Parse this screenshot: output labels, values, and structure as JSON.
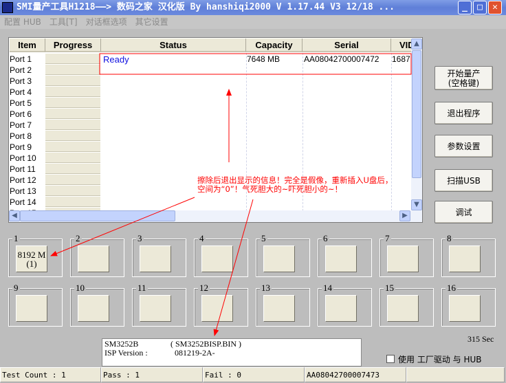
{
  "window": {
    "title": "SMI量产工具H1218——> 数码之家 汉化版 By hanshiqi2000      V 1.17.44 V3 12/18 ...",
    "minimize": "_",
    "maximize": "□",
    "close": "✕"
  },
  "menu": [
    "配置 HUB",
    "工具[T]",
    "对话框选项",
    "其它设置"
  ],
  "table": {
    "headers": [
      "Item",
      "Progress",
      "Status",
      "Capacity",
      "Serial",
      "VID"
    ],
    "rows": [
      "Port 1",
      "Port 2",
      "Port 3",
      "Port 4",
      "Port 5",
      "Port 6",
      "Port 7",
      "Port 8",
      "Port 9",
      "Port 10",
      "Port 11",
      "Port 12",
      "Port 13",
      "Port 14",
      "Port 15"
    ],
    "port1": {
      "status": "Ready",
      "capacity": "7648 MB",
      "serial": "AA08042700007472",
      "vid": "1687"
    }
  },
  "buttons": [
    "开始量产\n(空格键)",
    "退出程序",
    "参数设置",
    "扫描USB",
    "调试"
  ],
  "ports": [
    {
      "n": "1",
      "text": "8192 M\n(1)"
    },
    {
      "n": "2",
      "text": ""
    },
    {
      "n": "3",
      "text": ""
    },
    {
      "n": "4",
      "text": ""
    },
    {
      "n": "5",
      "text": ""
    },
    {
      "n": "6",
      "text": ""
    },
    {
      "n": "7",
      "text": ""
    },
    {
      "n": "8",
      "text": ""
    },
    {
      "n": "9",
      "text": ""
    },
    {
      "n": "10",
      "text": ""
    },
    {
      "n": "11",
      "text": ""
    },
    {
      "n": "12",
      "text": ""
    },
    {
      "n": "13",
      "text": ""
    },
    {
      "n": "14",
      "text": ""
    },
    {
      "n": "15",
      "text": ""
    },
    {
      "n": "16",
      "text": ""
    }
  ],
  "info": {
    "line1_a": "SM3252B",
    "line1_b": "( SM3252BISP.BIN )",
    "line2_a": "ISP Version :",
    "line2_b": "081219-2A-"
  },
  "timer": "315 Sec",
  "checkbox": {
    "label": "使用 工厂驱动 与 HUB",
    "checked": false
  },
  "statusbar": [
    "Test Count : 1",
    "Pass : 1",
    "Fail : 0",
    "AA08042700007473",
    ""
  ],
  "annotation": {
    "line1": "擦除后退出显示的信息！完全是假像，重新插入U盘后，",
    "line2": "空间为“0”！气死胆大的~吓死胆小的~！",
    "color": "#ff0000"
  }
}
